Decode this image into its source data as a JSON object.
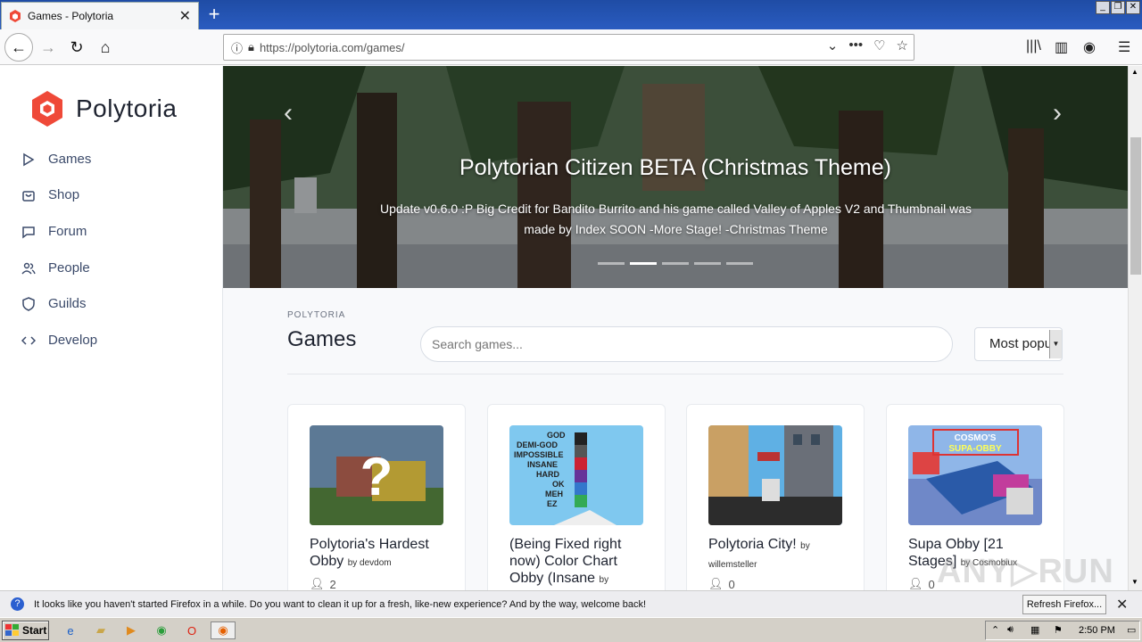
{
  "browser": {
    "tab_title": "Games - Polytoria",
    "url_host": "https://polytoria.com",
    "url_path": "/games/"
  },
  "sidebar": {
    "brand": "Polytoria",
    "items": [
      {
        "label": "Games",
        "icon": "play-icon"
      },
      {
        "label": "Shop",
        "icon": "bag-icon"
      },
      {
        "label": "Forum",
        "icon": "chat-icon"
      },
      {
        "label": "People",
        "icon": "people-icon"
      },
      {
        "label": "Guilds",
        "icon": "shield-icon"
      },
      {
        "label": "Develop",
        "icon": "code-icon"
      }
    ]
  },
  "hero": {
    "title": "Polytorian Citizen BETA (Christmas Theme)",
    "description": "Update v0.6.0 :P Big Credit for Bandito Burrito and his game called Valley of Apples V2 and Thumbnail was made by Index SOON -More Stage! -Christmas Theme",
    "active_slide": 2,
    "slide_count": 5
  },
  "main": {
    "eyebrow": "POLYTORIA",
    "heading": "Games",
    "search_placeholder": "Search games...",
    "sort_selected": "Most popular"
  },
  "games": [
    {
      "title": "Polytoria's Hardest Obby",
      "by": "by devdom",
      "players": "2"
    },
    {
      "title": "(Being Fixed right now) Color Chart Obby (Insane",
      "by": "by",
      "players": ""
    },
    {
      "title": "Polytoria City!",
      "by": "by willemsteller",
      "players": "0"
    },
    {
      "title": "Supa Obby [21 Stages]",
      "by": "by Cosmobiux",
      "players": "0"
    }
  ],
  "notification": {
    "message": "It looks like you haven't started Firefox in a while. Do you want to clean it up for a fresh, like-new experience? And by the way, welcome back!",
    "button": "Refresh Firefox..."
  },
  "taskbar": {
    "start": "Start",
    "clock": "2:50 PM"
  },
  "colors": {
    "brand": "#ef4938",
    "nav_text": "#3b4a6a",
    "titlebar": "#2a5cc0"
  }
}
